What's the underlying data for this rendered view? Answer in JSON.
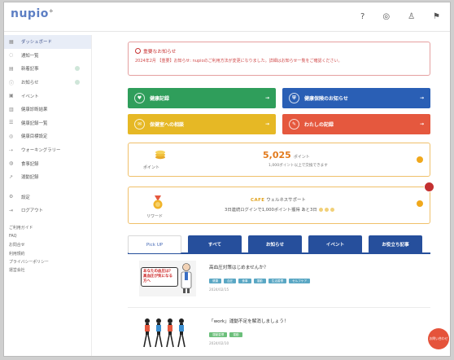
{
  "app": {
    "logo": "nupio",
    "logo_mark": "+"
  },
  "topbar": {
    "icons": [
      "help-icon",
      "globe-icon",
      "user-icon",
      "flag-icon"
    ]
  },
  "sidebar": {
    "items": [
      {
        "label": "ダッシュボード",
        "icon": "dashboard-icon",
        "active": true
      },
      {
        "label": "通知一覧",
        "icon": "bell-icon"
      },
      {
        "label": "新着記事",
        "icon": "doc-icon",
        "badge": true
      },
      {
        "label": "お知らせ",
        "icon": "info-icon",
        "badge": true
      },
      {
        "label": "イベント",
        "icon": "calendar-icon"
      },
      {
        "label": "健康診断結果",
        "icon": "chart-icon"
      },
      {
        "label": "健康記録一覧",
        "icon": "list-icon"
      },
      {
        "label": "健康目標設定",
        "icon": "target-icon"
      },
      {
        "label": "ウォーキングラリー",
        "icon": "walk-icon"
      },
      {
        "label": "食事記録",
        "icon": "food-icon"
      },
      {
        "label": "運動記録",
        "icon": "run-icon"
      }
    ],
    "bottom": [
      {
        "label": "設定",
        "icon": "gear-icon"
      },
      {
        "label": "ログアウト",
        "icon": "logout-icon"
      }
    ],
    "links": [
      "ご利用ガイド",
      "FAQ",
      "お問合せ",
      "利用規約",
      "プライバシーポリシー",
      "運営会社"
    ]
  },
  "alert": {
    "title": "重要なお知らせ",
    "body": "2024年2月 【重要】お知らせ: nupioのご利用方法が変更になりました。詳細はお知らせ一覧をご確認ください。"
  },
  "tiles": [
    {
      "label": "健康記録",
      "color": "#2f9e5b",
      "icon": "heart-icon"
    },
    {
      "label": "健康保険のお知らせ",
      "color": "#2a5fb5",
      "icon": "shield-icon"
    },
    {
      "label": "保健室への相談",
      "color": "#e6b825",
      "icon": "chat-icon"
    },
    {
      "label": "わたしの記録",
      "color": "#e5583e",
      "icon": "note-icon"
    }
  ],
  "points": {
    "label": "ポイント",
    "value": "5,025",
    "unit": "ポイント",
    "sub": "1,000ポイント以上で交換できます"
  },
  "rewards": {
    "label": "リワード",
    "line1_brand": "CAFE",
    "line1": "ウェルネスサポート",
    "line2": "3日連続ログインで1,000ポイント獲得 あと3日"
  },
  "tabs": [
    "Pick UP",
    "すべて",
    "お知らせ",
    "イベント",
    "お役立ち記事"
  ],
  "articles": [
    {
      "title": "高血圧対策はじめませんか？",
      "thumb_text": "あなたの血圧は？ 高血圧が気になる方へ",
      "chips": [
        "健康",
        "血圧",
        "食事",
        "運動",
        "生活習慣",
        "セルフケア"
      ],
      "date": "2024/02/15"
    },
    {
      "title": "「work」運動不足を解消しましょう！",
      "chips": [
        "運動習慣",
        "運動"
      ],
      "date": "2024/02/10"
    }
  ],
  "fab": {
    "label": "お問い合わせ"
  }
}
